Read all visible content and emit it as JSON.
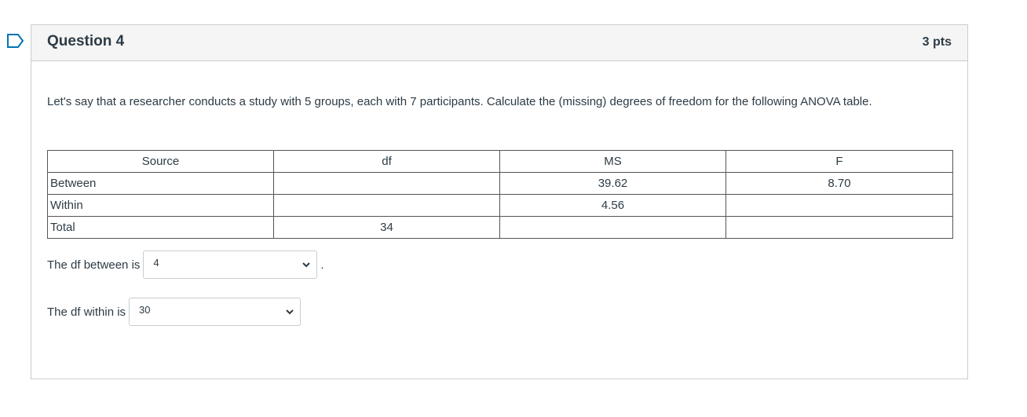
{
  "question": {
    "title": "Question 4",
    "points": "3 pts",
    "prompt": "Let's say that a researcher conducts a study with 5 groups, each with 7 participants. Calculate the (missing) degrees of freedom for the following ANOVA table."
  },
  "table": {
    "headers": [
      "Source",
      "df",
      "MS",
      "F"
    ],
    "rows": [
      {
        "source": "Between",
        "df": "",
        "ms": "39.62",
        "f": "8.70"
      },
      {
        "source": "Within",
        "df": "",
        "ms": "4.56",
        "f": ""
      },
      {
        "source": "Total",
        "df": "34",
        "ms": "",
        "f": ""
      }
    ]
  },
  "answers": {
    "between_label": "The df between is",
    "between_value": "4",
    "between_suffix": ".",
    "within_label": "The df within is",
    "within_value": "30"
  },
  "icons": {
    "flag": "bookmark-flag-icon",
    "dropdown": "chevron-down-icon"
  },
  "colors": {
    "flag": "#0374b5",
    "header_bg": "#f5f5f5",
    "border": "#c7cdd1",
    "text": "#2d3b45"
  }
}
